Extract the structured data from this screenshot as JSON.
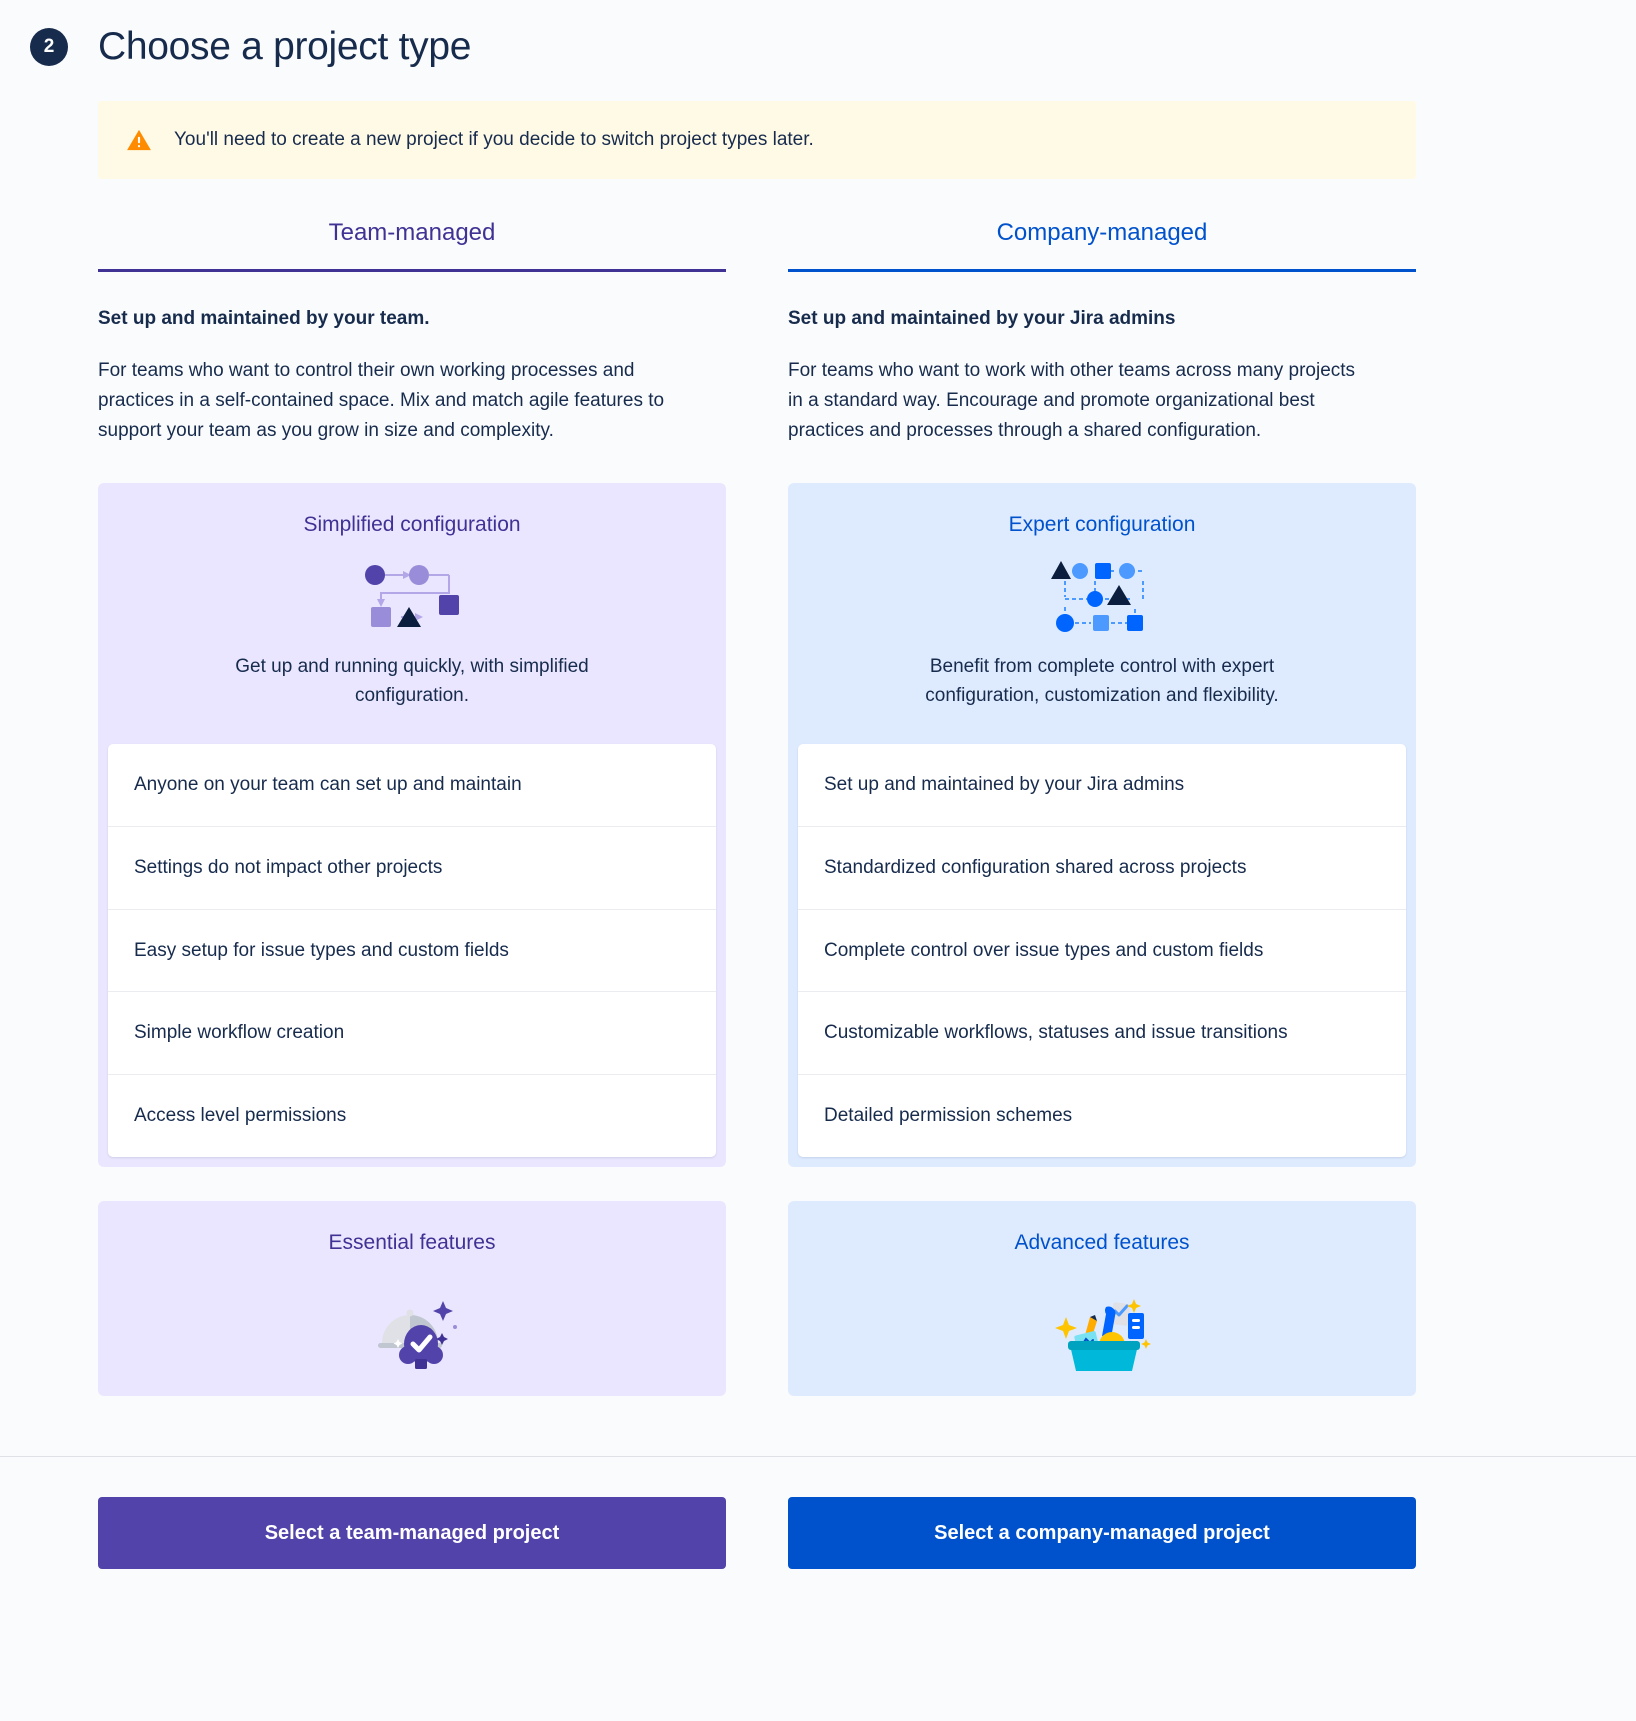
{
  "header": {
    "step_number": "2",
    "title": "Choose a project type"
  },
  "warning": {
    "icon": "warning-triangle-icon",
    "message": "You'll need to create a new project if you decide to switch project types later."
  },
  "colors": {
    "team_accent": "#403294",
    "team_button": "#5243AA",
    "team_panel": "#EAE6FF",
    "company_accent": "#0052CC",
    "company_button": "#0052CC",
    "company_panel": "#DEEBFF",
    "warning_bg": "#FFFAE6",
    "warning_icon": "#FF8B00",
    "page_bg": "#FAFBFC",
    "text": "#172B4D"
  },
  "columns": [
    {
      "id": "team-managed",
      "tab_label": "Team-managed",
      "heading": "Set up and maintained by your team.",
      "description": "For teams who want to control their own working processes and practices in a self-contained space. Mix and match agile features to support your team as you grow in size and complexity.",
      "config": {
        "title": "Simplified configuration",
        "icon": "simplified-workflow-diagram-icon",
        "subtitle": "Get up and running quickly, with simplified configuration."
      },
      "features": [
        "Anyone on your team can set up and maintain",
        "Settings do not impact other projects",
        "Easy setup for issue types and custom fields",
        "Simple workflow creation",
        "Access level permissions"
      ],
      "bottom_card": {
        "title": "Essential features",
        "icon": "essential-features-illustration-icon"
      },
      "button_label": "Select a team-managed project"
    },
    {
      "id": "company-managed",
      "tab_label": "Company-managed",
      "heading": "Set up and maintained by your Jira admins",
      "description": "For teams who want to work with other teams across many projects in a standard way. Encourage and promote organizational best practices and processes through a shared configuration.",
      "config": {
        "title": "Expert configuration",
        "icon": "expert-workflow-diagram-icon",
        "subtitle": "Benefit from complete control with expert configuration, customization and flexibility."
      },
      "features": [
        "Set up and maintained by your Jira admins",
        "Standardized configuration shared across projects",
        "Complete control over issue types and custom fields",
        "Customizable workflows, statuses and issue transitions",
        "Detailed permission schemes"
      ],
      "bottom_card": {
        "title": "Advanced features",
        "icon": "advanced-features-illustration-icon"
      },
      "button_label": "Select a company-managed project"
    }
  ]
}
